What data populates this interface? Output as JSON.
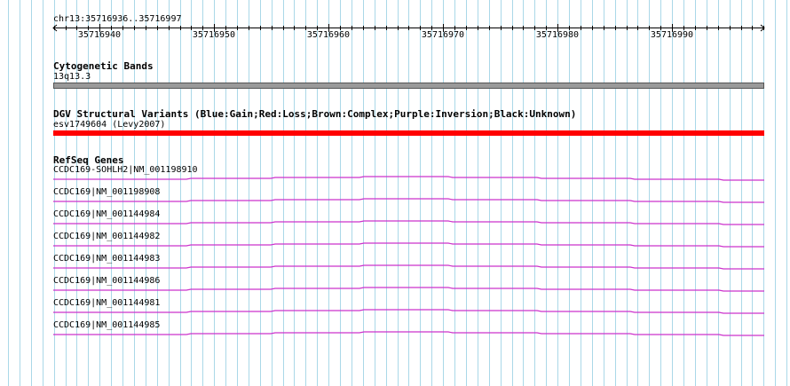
{
  "position_label": "chr13:35716936..35716997",
  "ruler_ticks": [
    "35716940",
    "35716950",
    "35716960",
    "35716970",
    "35716980",
    "35716990"
  ],
  "tracks": {
    "cytoband": {
      "title": "Cytogenetic Bands",
      "label": "13q13.3",
      "color": "#9a9a9a"
    },
    "dgv": {
      "title": "DGV Structural Variants (Blue:Gain;Red:Loss;Brown:Complex;Purple:Inversion;Black:Unknown)",
      "label": "esv1749604 (Levy2007)",
      "color": "#ff0000"
    },
    "refseq": {
      "title": "RefSeq Genes",
      "color": "#cc33cc",
      "genes": [
        "CCDC169-SOHLH2|NM_001198910",
        "CCDC169|NM_001198908",
        "CCDC169|NM_001144984",
        "CCDC169|NM_001144982",
        "CCDC169|NM_001144983",
        "CCDC169|NM_001144986",
        "CCDC169|NM_001144981",
        "CCDC169|NM_001144985"
      ]
    }
  },
  "colors": {
    "grid": "#aad8e8",
    "ruler": "#000000"
  }
}
